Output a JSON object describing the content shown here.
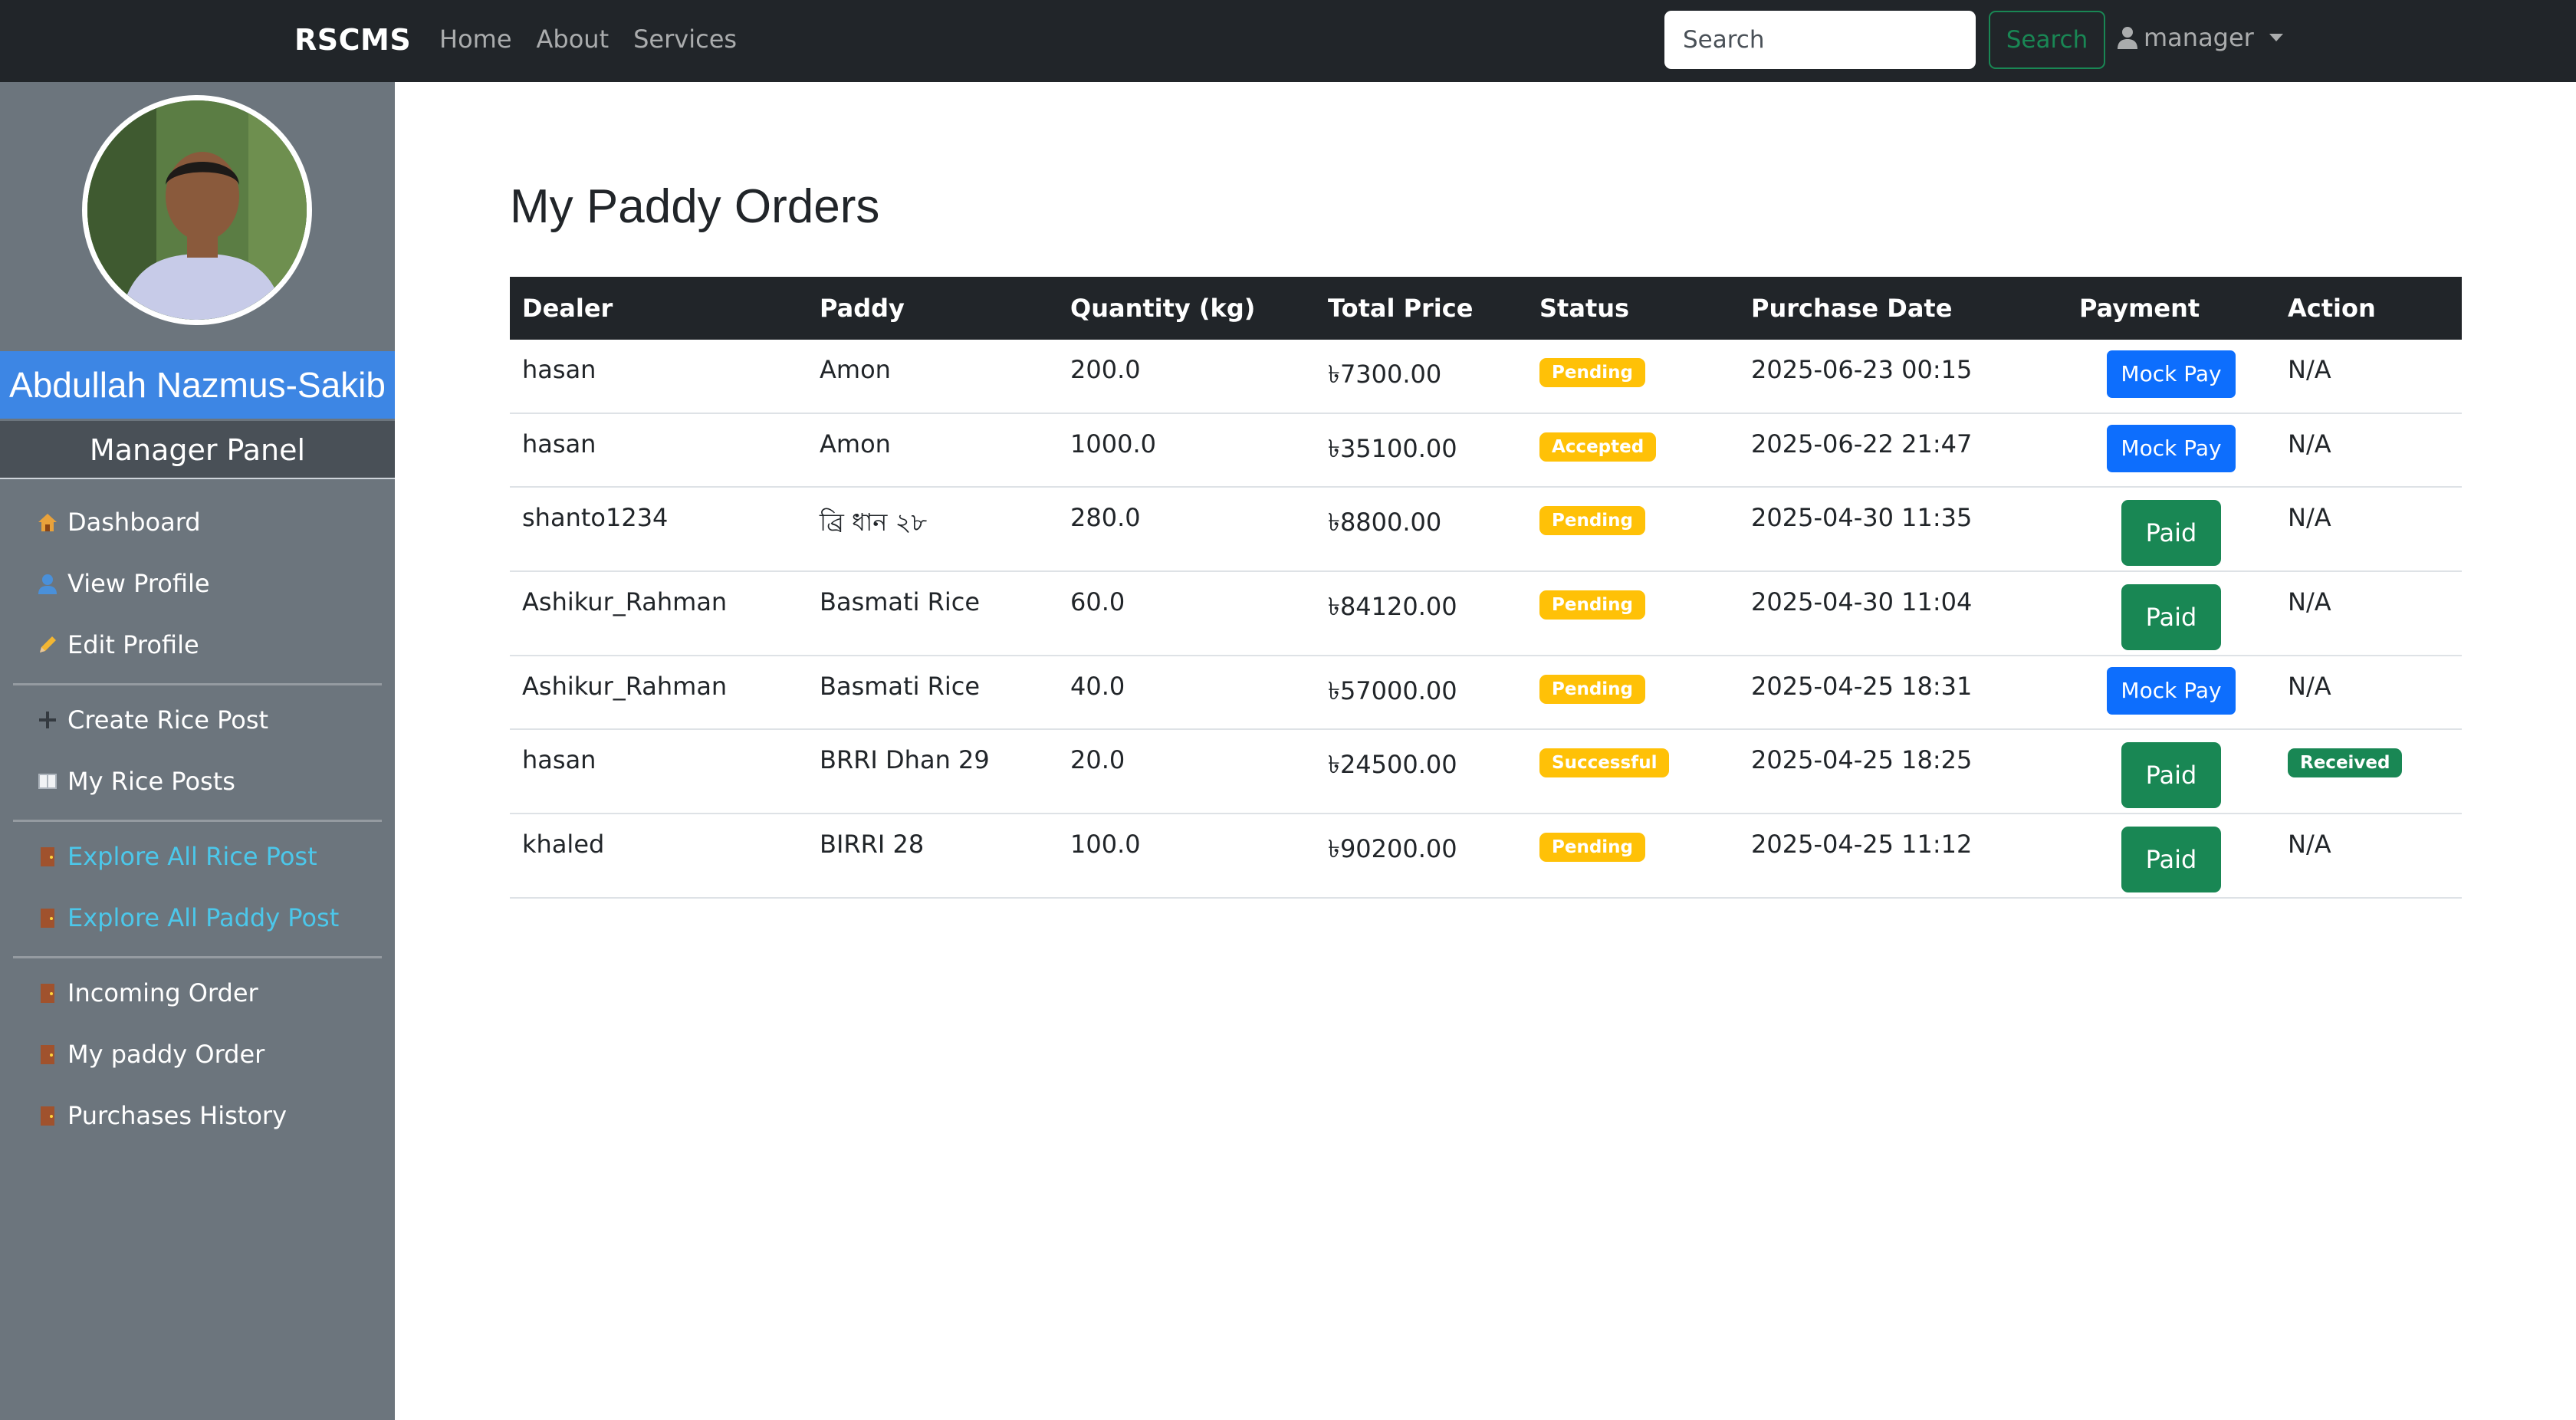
{
  "navbar": {
    "brand": "RSCMS",
    "links": [
      "Home",
      "About",
      "Services"
    ],
    "search_placeholder": "Search",
    "search_button": "Search",
    "user_label": "manager"
  },
  "sidebar": {
    "profile_name": "Abdullah Nazmus-Sakib",
    "panel_title": "Manager Panel",
    "items": [
      {
        "icon": "house-icon",
        "label": "Dashboard"
      },
      {
        "icon": "user-icon",
        "label": "View Profile"
      },
      {
        "icon": "pencil-icon",
        "label": "Edit Profile"
      },
      {
        "icon": "plus-icon",
        "label": "Create Rice Post"
      },
      {
        "icon": "book-icon",
        "label": "My Rice Posts"
      },
      {
        "icon": "door-icon",
        "label": "Explore All Rice Post"
      },
      {
        "icon": "door-icon",
        "label": "Explore All Paddy Post"
      },
      {
        "icon": "door-icon",
        "label": "Incoming Order"
      },
      {
        "icon": "door-icon",
        "label": "My paddy Order"
      },
      {
        "icon": "door-icon",
        "label": "Purchases History"
      }
    ]
  },
  "main": {
    "title": "My Paddy Orders",
    "columns": [
      "Dealer",
      "Paddy",
      "Quantity (kg)",
      "Total Price",
      "Status",
      "Purchase Date",
      "Payment",
      "Action"
    ],
    "rows": [
      {
        "dealer": "hasan",
        "paddy": "Amon",
        "quantity": "200.0",
        "price": "৳7300.00",
        "status": "Pending",
        "date": "2025-06-23 00:15",
        "payment": "Mock Pay",
        "action": "N/A"
      },
      {
        "dealer": "hasan",
        "paddy": "Amon",
        "quantity": "1000.0",
        "price": "৳35100.00",
        "status": "Accepted",
        "date": "2025-06-22 21:47",
        "payment": "Mock Pay",
        "action": "N/A"
      },
      {
        "dealer": "shanto1234",
        "paddy": "ব্রি ধান ২৮",
        "quantity": "280.0",
        "price": "৳8800.00",
        "status": "Pending",
        "date": "2025-04-30 11:35",
        "payment": "Paid",
        "action": "N/A"
      },
      {
        "dealer": "Ashikur_Rahman",
        "paddy": "Basmati Rice",
        "quantity": "60.0",
        "price": "৳84120.00",
        "status": "Pending",
        "date": "2025-04-30 11:04",
        "payment": "Paid",
        "action": "N/A"
      },
      {
        "dealer": "Ashikur_Rahman",
        "paddy": "Basmati Rice",
        "quantity": "40.0",
        "price": "৳57000.00",
        "status": "Pending",
        "date": "2025-04-25 18:31",
        "payment": "Mock Pay",
        "action": "N/A"
      },
      {
        "dealer": "hasan",
        "paddy": "BRRI Dhan 29",
        "quantity": "20.0",
        "price": "৳24500.00",
        "status": "Successful",
        "date": "2025-04-25 18:25",
        "payment": "Paid",
        "action": "Received"
      },
      {
        "dealer": "khaled",
        "paddy": "BIRRI 28",
        "quantity": "100.0",
        "price": "৳90200.00",
        "status": "Pending",
        "date": "2025-04-25 11:12",
        "payment": "Paid",
        "action": "N/A"
      }
    ]
  },
  "colors": {
    "navbar_bg": "#212529",
    "sidebar_bg": "#6c757d",
    "name_banner": "#3d86e4",
    "warning": "#ffc107",
    "success": "#198754",
    "primary": "#0d6efd",
    "info_link": "#4cc7ea"
  }
}
